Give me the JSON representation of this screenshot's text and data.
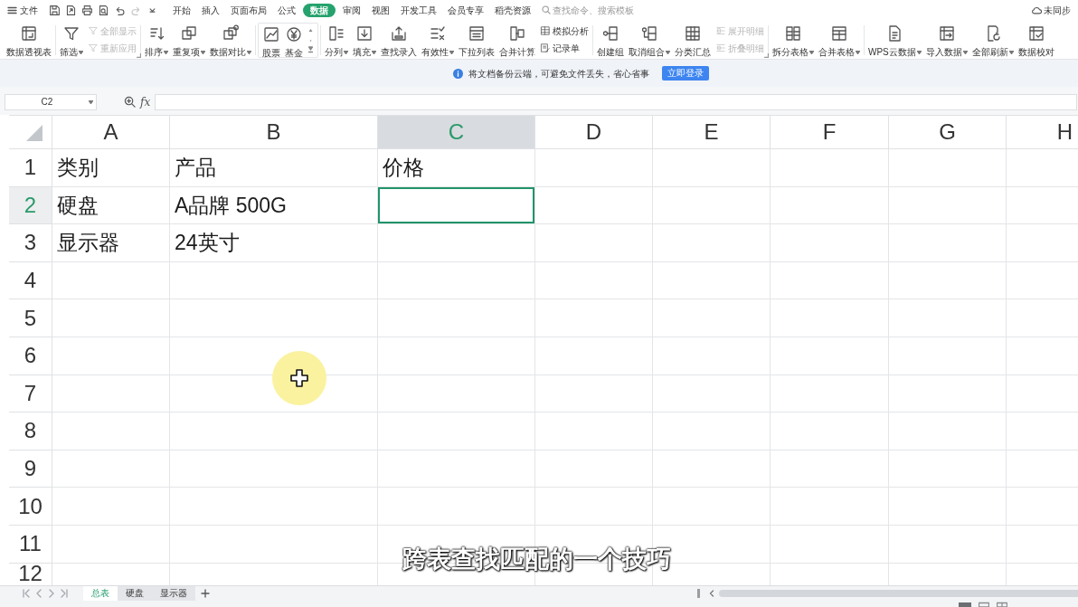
{
  "menu_bar": {
    "file_menu": "文件",
    "tabs": [
      {
        "label": "开始",
        "selected": false
      },
      {
        "label": "插入",
        "selected": false
      },
      {
        "label": "页面布局",
        "selected": false
      },
      {
        "label": "公式",
        "selected": false
      },
      {
        "label": "数据",
        "selected": true
      },
      {
        "label": "审阅",
        "selected": false
      },
      {
        "label": "视图",
        "selected": false
      },
      {
        "label": "开发工具",
        "selected": false
      },
      {
        "label": "会员专享",
        "selected": false
      },
      {
        "label": "稻壳资源",
        "selected": false
      }
    ],
    "search": {
      "placeholder": "查找命令、搜索模板"
    },
    "sync_status": "未同步"
  },
  "ribbon": {
    "groups": [
      {
        "kind": "plain",
        "items": [
          {
            "kind": "large",
            "label": "数据透视表",
            "dropdown": false
          }
        ]
      },
      {
        "kind": "plain",
        "launcher": true,
        "items": [
          {
            "kind": "large",
            "label": "筛选",
            "dropdown": true
          },
          {
            "kind": "stack",
            "items": [
              {
                "label": "全部显示",
                "disabled": true
              },
              {
                "label": "重新应用",
                "disabled": true
              }
            ]
          }
        ]
      },
      {
        "kind": "plain",
        "items": [
          {
            "kind": "large",
            "label": "排序",
            "dropdown": true
          },
          {
            "kind": "large",
            "label": "重复项",
            "dropdown": true
          },
          {
            "kind": "large",
            "label": "数据对比",
            "dropdown": true
          }
        ]
      },
      {
        "kind": "gallery",
        "items": [
          {
            "kind": "large",
            "label": "股票",
            "dropdown": false
          },
          {
            "kind": "large",
            "label": "基金",
            "dropdown": false
          },
          {
            "kind": "scroll"
          }
        ]
      },
      {
        "kind": "plain",
        "items": [
          {
            "kind": "large",
            "label": "分列",
            "dropdown": true
          },
          {
            "kind": "large",
            "label": "填充",
            "dropdown": true
          },
          {
            "kind": "large",
            "label": "查找录入",
            "dropdown": false
          },
          {
            "kind": "large",
            "label": "有效性",
            "dropdown": true
          },
          {
            "kind": "large",
            "label": "下拉列表",
            "dropdown": false
          },
          {
            "kind": "large",
            "label": "合并计算",
            "dropdown": false
          },
          {
            "kind": "stack",
            "items": [
              {
                "label": "模拟分析",
                "disabled": false
              },
              {
                "label": "记录单",
                "disabled": false
              }
            ]
          }
        ]
      },
      {
        "kind": "plain",
        "launcher": true,
        "items": [
          {
            "kind": "large",
            "label": "创建组",
            "dropdown": false
          },
          {
            "kind": "large",
            "label": "取消组合",
            "dropdown": true
          },
          {
            "kind": "large",
            "label": "分类汇总",
            "dropdown": false
          },
          {
            "kind": "stack",
            "items": [
              {
                "label": "展开明细",
                "disabled": true
              },
              {
                "label": "折叠明细",
                "disabled": true
              }
            ]
          }
        ]
      },
      {
        "kind": "plain",
        "items": [
          {
            "kind": "large",
            "label": "拆分表格",
            "dropdown": true
          },
          {
            "kind": "large",
            "label": "合并表格",
            "dropdown": true
          }
        ]
      },
      {
        "kind": "plain",
        "items": [
          {
            "kind": "large",
            "label": "WPS云数据",
            "dropdown": true
          },
          {
            "kind": "large",
            "label": "导入数据",
            "dropdown": true
          },
          {
            "kind": "large",
            "label": "全部刷新",
            "dropdown": true
          },
          {
            "kind": "large",
            "label": "数据校对",
            "dropdown": false
          }
        ]
      }
    ]
  },
  "notification": {
    "message": "将文档备份云端，可避免文件丢失，省心省事",
    "button": "立即登录"
  },
  "formula_bar": {
    "name_box": "C2",
    "function_label": "fx"
  },
  "sheet": {
    "columns": [
      {
        "label": "A",
        "selected": false
      },
      {
        "label": "B",
        "selected": false
      },
      {
        "label": "C",
        "selected": true
      },
      {
        "label": "D",
        "selected": false
      },
      {
        "label": "E",
        "selected": false
      },
      {
        "label": "F",
        "selected": false
      },
      {
        "label": "G",
        "selected": false
      },
      {
        "label": "H",
        "selected": false
      }
    ],
    "rows": [
      {
        "label": "1",
        "selected": false,
        "cells": [
          "类别",
          "产品",
          "价格"
        ]
      },
      {
        "label": "2",
        "selected": true,
        "cells": [
          "硬盘",
          "A品牌 500G"
        ]
      },
      {
        "label": "3",
        "selected": false,
        "cells": [
          "显示器",
          "24英寸"
        ]
      },
      {
        "label": "4",
        "selected": false
      },
      {
        "label": "5",
        "selected": false
      },
      {
        "label": "6",
        "selected": false
      },
      {
        "label": "7",
        "selected": false
      },
      {
        "label": "8",
        "selected": false
      },
      {
        "label": "9",
        "selected": false
      },
      {
        "label": "10",
        "selected": false
      },
      {
        "label": "11",
        "selected": false
      },
      {
        "label": "12",
        "selected": false
      }
    ]
  },
  "sheet_tabs": [
    {
      "label": "总表",
      "selected": true
    },
    {
      "label": "硬盘",
      "selected": false
    },
    {
      "label": "显示器",
      "selected": false
    }
  ],
  "subtitle": "跨表查找匹配的一个技巧"
}
